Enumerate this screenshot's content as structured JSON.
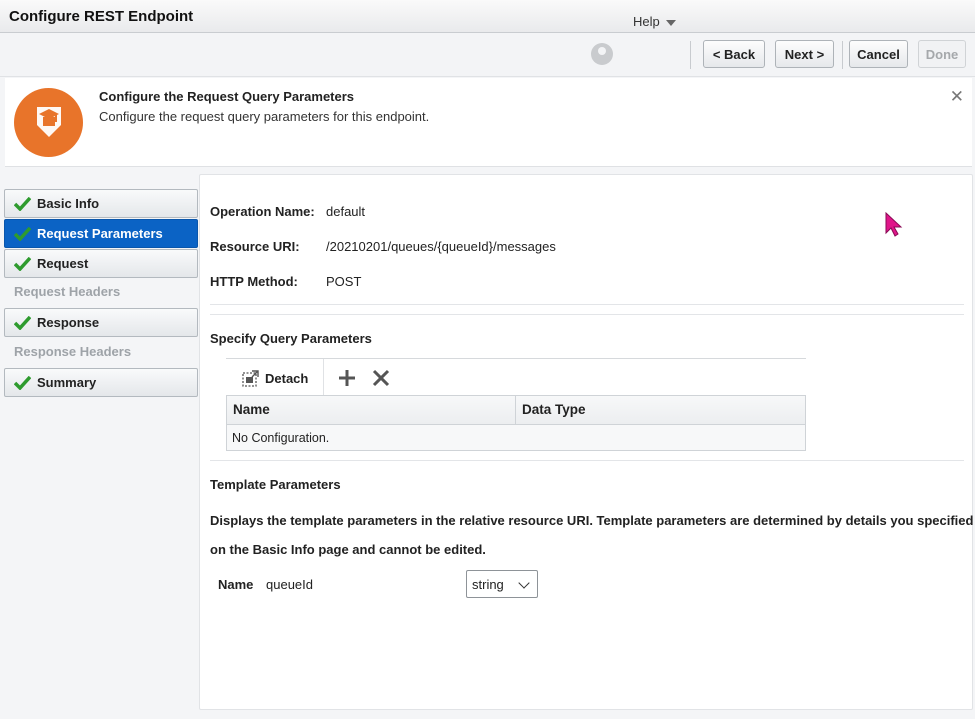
{
  "window": {
    "title": "Configure REST Endpoint"
  },
  "toolbar": {
    "help_label": "Help",
    "back_label": "< Back",
    "next_label": "Next >",
    "cancel_label": "Cancel",
    "done_label": "Done"
  },
  "header": {
    "title": "Configure the Request Query Parameters",
    "subtitle": "Configure the request query parameters for this endpoint.",
    "close_glyph": "✕"
  },
  "nav": {
    "items": [
      {
        "label": "Basic Info",
        "checked": true
      },
      {
        "label": "Request Parameters",
        "checked": true,
        "active": true
      },
      {
        "label": "Request",
        "checked": true
      },
      {
        "label": "Request Headers",
        "disabled": true
      },
      {
        "label": "Response",
        "checked": true
      },
      {
        "label": "Response Headers",
        "disabled": true
      },
      {
        "label": "Summary",
        "checked": true
      }
    ]
  },
  "details": {
    "operation_name_label": "Operation Name:",
    "operation_name": "default",
    "resource_uri_label": "Resource URI:",
    "resource_uri": "/20210201/queues/{queueId}/messages",
    "http_method_label": "HTTP Method:",
    "http_method": "POST"
  },
  "query_params": {
    "section_title": "Specify Query Parameters",
    "detach_label": "Detach",
    "columns": [
      "Name",
      "Data Type"
    ],
    "empty_text": "No Configuration."
  },
  "template_params": {
    "section_title": "Template Parameters",
    "description_line1": "Displays the template parameters in the relative resource URI. Template parameters are determined by details you specified",
    "description_line2": "on the Basic Info page and cannot be edited.",
    "name_label": "Name",
    "name_value": "queueId",
    "type_value": "string"
  },
  "colors": {
    "accent": "#0b63c5",
    "badge": "#e8742a",
    "check": "#2e9b2e",
    "cursor": "#e0168a"
  }
}
